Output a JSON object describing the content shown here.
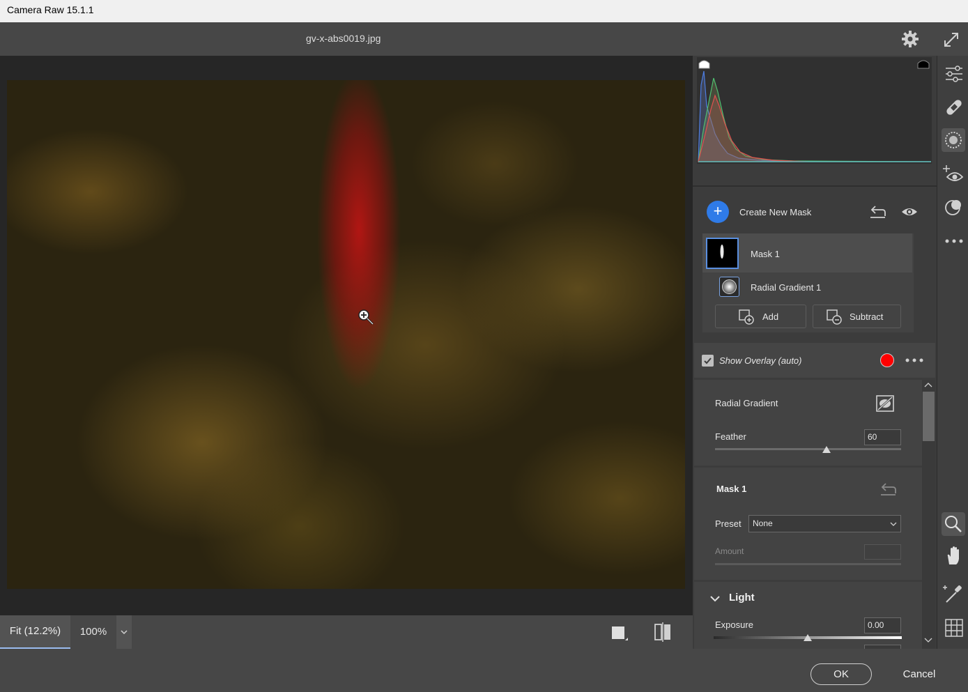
{
  "window": {
    "title": "Camera Raw 15.1.1"
  },
  "header": {
    "filename": "gv-x-abs0019.jpg",
    "settings_icon": "gear-icon",
    "fullscreen_icon": "expand-icon"
  },
  "zoom": {
    "fit_label": "Fit (12.2%)",
    "percent_label": "100%"
  },
  "masking": {
    "create_label": "Create New Mask",
    "masks": [
      {
        "name": "Mask 1",
        "components": [
          "Radial Gradient 1"
        ]
      }
    ],
    "add_label": "Add",
    "subtract_label": "Subtract",
    "overlay_label": "Show Overlay (auto)",
    "overlay_checked": true,
    "overlay_color": "#ff0000"
  },
  "radial_gradient": {
    "title": "Radial Gradient",
    "feather_label": "Feather",
    "feather_value": "60",
    "feather_fraction": 0.6
  },
  "mask_settings": {
    "title": "Mask 1",
    "preset_label": "Preset",
    "preset_value": "None",
    "amount_label": "Amount"
  },
  "light": {
    "title": "Light",
    "exposure_label": "Exposure",
    "exposure_value": "0.00",
    "exposure_fraction": 0.5
  },
  "footer": {
    "ok_label": "OK",
    "cancel_label": "Cancel"
  },
  "toolbar": {
    "tools": [
      "edit-sliders-icon",
      "healing-brush-icon",
      "masking-icon",
      "red-eye-icon",
      "presets-icon",
      "more-icon",
      "zoom-icon",
      "hand-icon",
      "color-sampler-icon",
      "grid-icon"
    ],
    "active_tool": "masking-icon"
  },
  "colors": {
    "accent": "#2f7be8",
    "panel": "#3c3c3c",
    "canvas": "#262626"
  }
}
